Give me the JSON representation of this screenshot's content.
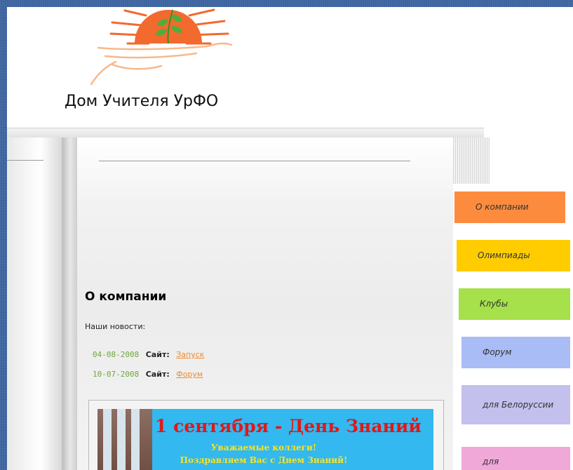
{
  "header": {
    "site_title": "Дом Учителя УрФО"
  },
  "colors": {
    "desktop_background": "#3f66a3",
    "news_date": "#6ca93a",
    "news_link": "#f08a2c",
    "logo_sun": "#f26a2e",
    "logo_leaf": "#4caf3a"
  },
  "content": {
    "section_title": "О компании",
    "news_label": "Наши новости:",
    "news": [
      {
        "date": "04-08-2008",
        "label": "Сайт:",
        "link": "Запуск"
      },
      {
        "date": "10-07-2008",
        "label": "Сайт:",
        "link": "Форум"
      }
    ]
  },
  "banner": {
    "title": "1 сентября - День Знаний",
    "line1": "Уважаемые коллеги!",
    "line2": "Поздравляем Вас с Днем Знаний!"
  },
  "nav_tabs": [
    {
      "label": "О компании",
      "color": "#fd8b3e"
    },
    {
      "label": "Олимпиады",
      "color": "#ffcc00"
    },
    {
      "label": "Клубы",
      "color": "#a6e04a"
    },
    {
      "label": "Форум",
      "color": "#a9bcf5"
    },
    {
      "label": "для Белоруссии",
      "color": "#c3c0ee"
    },
    {
      "label": "для",
      "color": "#f0a8d8"
    }
  ]
}
